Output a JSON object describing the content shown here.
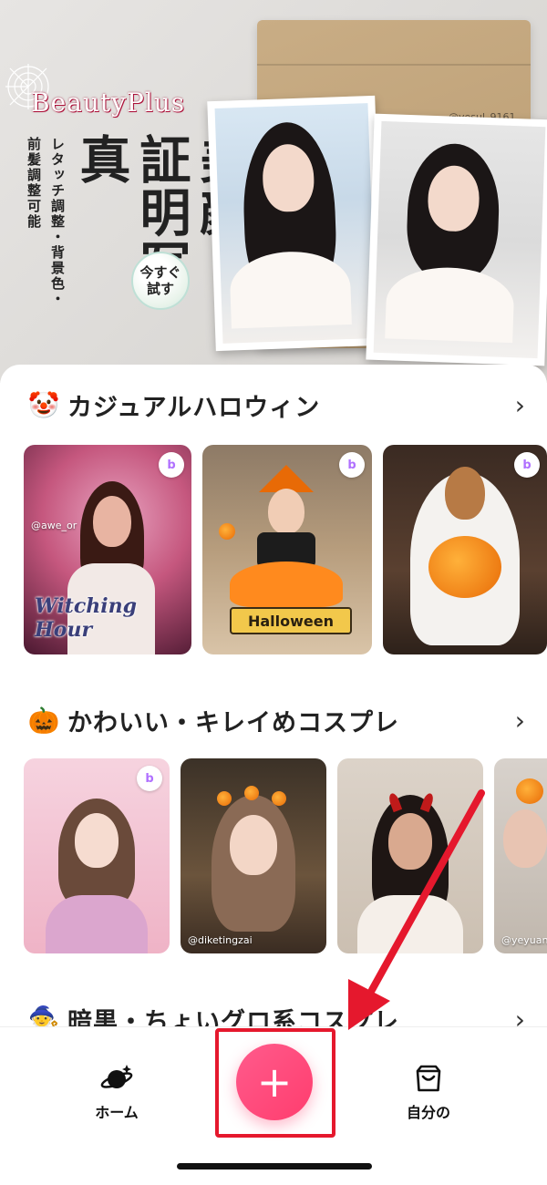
{
  "banner": {
    "logo": "BeautyPlus",
    "title": "美顔証明写真",
    "subtitle": "レタッチ調整・背景色・前髪調整可能",
    "subtitle_col1": "レタッチ調整・背景色・",
    "subtitle_col2": "前髪調整可能",
    "title_col1": "美顔",
    "title_col2": "証明写真",
    "cta": "今すぐ試す",
    "cta_line1": "今すぐ",
    "cta_line2": "試す",
    "handle": "@yesul_9161"
  },
  "sections": [
    {
      "emoji": "🤡",
      "title": "カジュアルハロウィン",
      "cards": [
        {
          "credit": "@awe_or",
          "overlay": "Witching Hour"
        },
        {
          "overlay": "Halloween"
        },
        {
          "overlay": ""
        }
      ]
    },
    {
      "emoji": "🎃",
      "title": "かわいい・キレイめコスプレ",
      "cards": [
        {
          "credit": ""
        },
        {
          "credit": "@diketingzai"
        },
        {
          "credit": ""
        },
        {
          "credit": "@yeyuanla"
        }
      ]
    },
    {
      "emoji": "🧙",
      "title": "暗黒・ちょいグロ系コスプレ"
    }
  ],
  "chevron": "›",
  "nav": {
    "home_label": "ホーム",
    "create_label": "+",
    "mine_label": "自分の"
  },
  "colors": {
    "accent": "#ff3d6e",
    "annotation": "#e5182d"
  }
}
